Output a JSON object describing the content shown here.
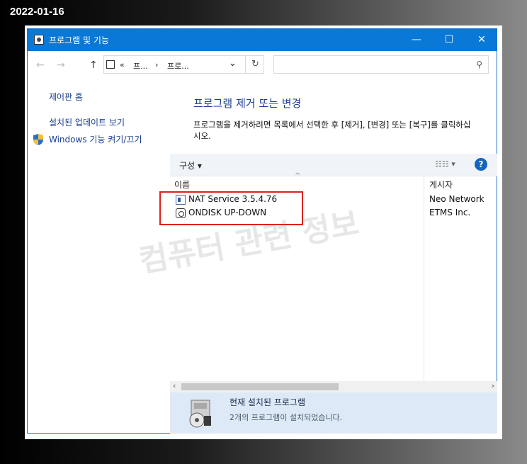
{
  "date_stamp": "2022-01-16",
  "window": {
    "title": "프로그램 및 기능",
    "minimize": "—",
    "maximize": "☐",
    "close": "✕"
  },
  "address": {
    "back": "←",
    "forward": "→",
    "up": "↑",
    "prefix": "«",
    "crumb1": "프...",
    "sep": "›",
    "crumb2": "프로...",
    "dropdown": "⌄",
    "refresh": "↻",
    "search_placeholder": "",
    "search_icon": "⚲"
  },
  "sidebar": {
    "items": [
      {
        "label": "제어판 홈"
      },
      {
        "label": "설치된 업데이트 보기"
      },
      {
        "label": "Windows 기능 켜기/끄기"
      }
    ]
  },
  "main": {
    "heading": "프로그램 제거 또는 변경",
    "description": "프로그램을 제거하려면 목록에서 선택한 후 [제거], [변경] 또는 [복구]를 클릭하십시오."
  },
  "toolbar": {
    "organize": "구성 ▾",
    "views": "☷☷ ▾",
    "help": "?"
  },
  "list": {
    "col_name": "이름",
    "col_publisher": "게시자",
    "sort_indicator": "^",
    "rows": [
      {
        "name": "NAT Service 3.5.4.76",
        "publisher": "Neo Network",
        "icon": "nat-service-icon"
      },
      {
        "name": "ONDISK UP-DOWN",
        "publisher": "ETMS Inc.",
        "icon": "ondisk-icon"
      }
    ]
  },
  "watermark": "컴퓨터 관련 정보",
  "scroll": {
    "left": "‹",
    "right": "›"
  },
  "details": {
    "title": "현재 설치된 프로그램",
    "subtitle": "2개의 프로그램이 설치되었습니다."
  },
  "colors": {
    "titlebar": "#0a78d7",
    "link": "#1a3c8c",
    "heading": "#1c3d8f",
    "highlight": "#e0201a",
    "details_bg": "#dde9f7"
  }
}
